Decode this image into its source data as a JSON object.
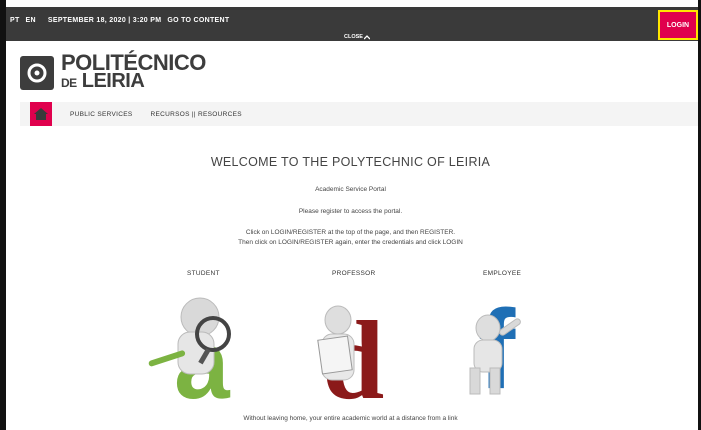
{
  "topbar": {
    "lang_pt": "PT",
    "lang_en": "EN",
    "datetime": "SEPTEMBER 18, 2020 | 3:20 PM",
    "go_to_content": "GO TO CONTENT",
    "close_label": "CLOSE",
    "login_label": "LOGIN"
  },
  "logo": {
    "line1": "POLITÉCNICO",
    "line2_prefix": "DE",
    "line2": "LEIRIA"
  },
  "nav": {
    "items": [
      {
        "label": "PUBLIC SERVICES"
      },
      {
        "label": "RECURSOS || RESOURCES"
      }
    ]
  },
  "main": {
    "title": "WELCOME TO THE POLYTECHNIC OF LEIRIA",
    "subtitle": "Academic Service Portal",
    "register_note": "Please register to access the portal.",
    "instructions_1": "Click on LOGIN/REGISTER at the top of the page, and then REGISTER.",
    "instructions_2": "Then click on LOGIN/REGISTER again, enter the credentials and click LOGIN",
    "roles": [
      {
        "label": "STUDENT",
        "letter": "a",
        "color": "#7cb342"
      },
      {
        "label": "PROFESSOR",
        "letter": "d",
        "color": "#8b1a1a"
      },
      {
        "label": "EMPLOYEE",
        "letter": "f",
        "color": "#1f6fb5"
      }
    ],
    "footer_text": "Without leaving home, your entire academic world at a distance from a link"
  },
  "colors": {
    "topbar_bg": "#3a3a3a",
    "accent": "#e0004d",
    "highlight": "#ffe600"
  }
}
